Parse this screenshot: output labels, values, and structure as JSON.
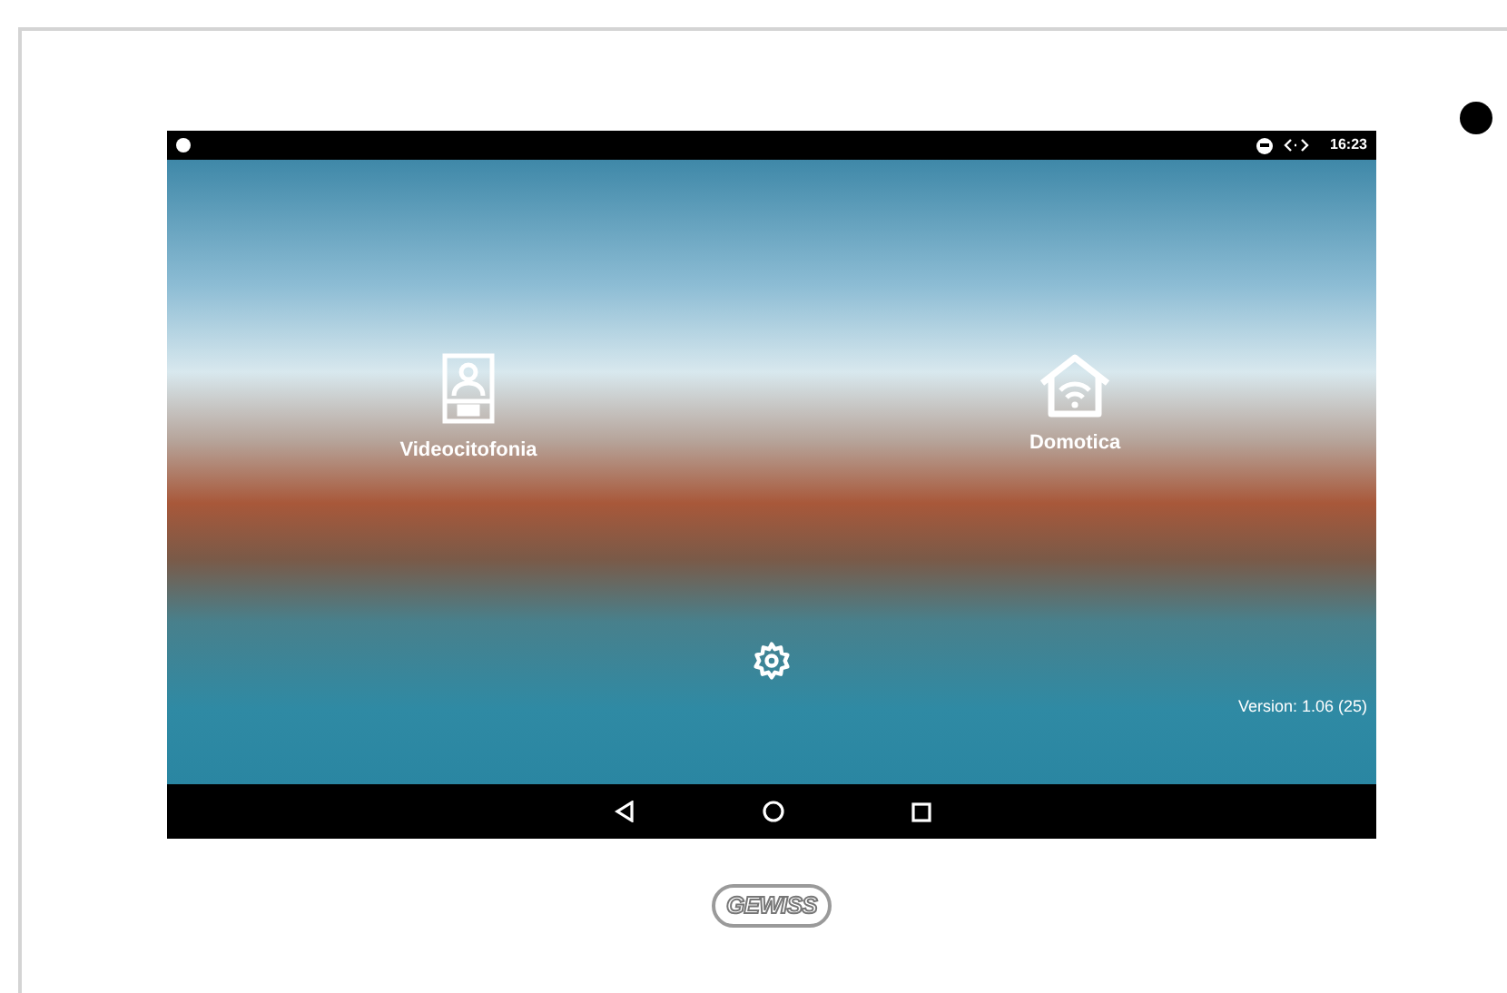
{
  "status_bar": {
    "time": "16:23"
  },
  "apps": [
    {
      "label": "Videocitofonia",
      "kind": "intercom"
    },
    {
      "label": "Domotica",
      "kind": "home"
    }
  ],
  "version": "Version: 1.06 (25)",
  "brand": "GEWISS"
}
